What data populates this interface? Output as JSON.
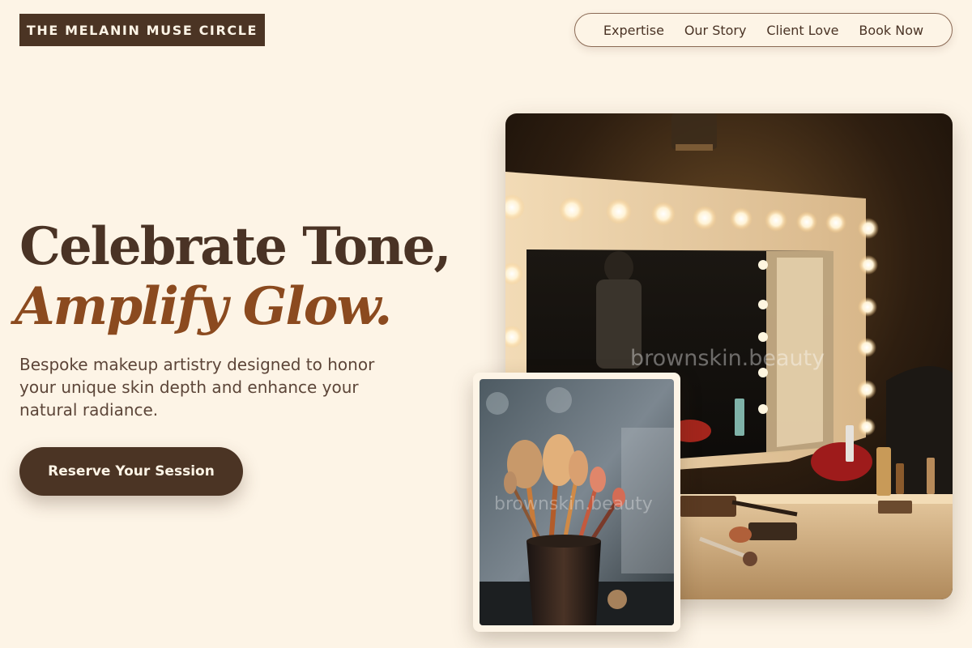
{
  "brand": {
    "name": "THE MELANIN MUSE CIRCLE"
  },
  "nav": {
    "items": [
      {
        "label": "Expertise"
      },
      {
        "label": "Our Story"
      },
      {
        "label": "Client Love"
      },
      {
        "label": "Book Now"
      }
    ]
  },
  "hero": {
    "headline_line1": "Celebrate Tone,",
    "headline_line2": "Amplify Glow.",
    "description": "Bespoke makeup artistry designed to honor your unique skin depth and enhance your natural radiance.",
    "cta_label": "Reserve Your Session"
  },
  "images": {
    "main_watermark": "brownskin.beauty",
    "small_watermark": "brownskin.beauty"
  },
  "colors": {
    "background": "#fdf4e6",
    "primary_brown": "#4b3424",
    "accent_rust": "#8b4a1f",
    "body_text": "#5c4538"
  }
}
